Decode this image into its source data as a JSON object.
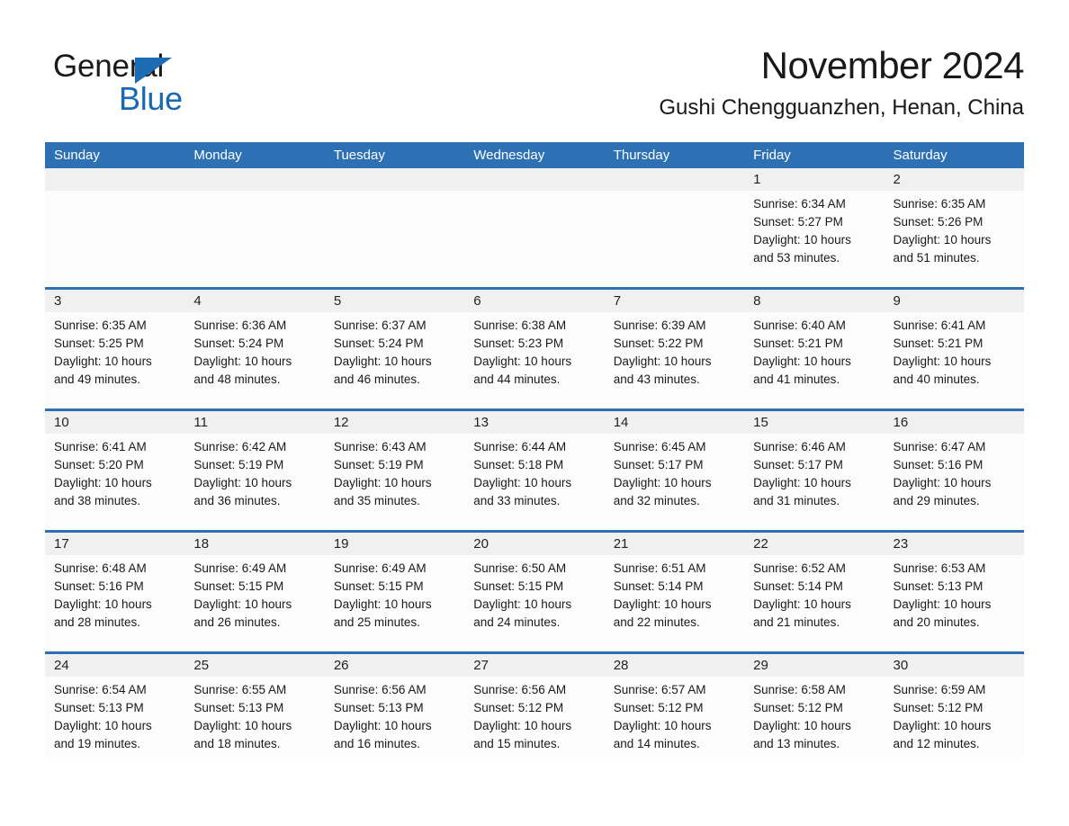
{
  "brand": {
    "name_part1": "General",
    "name_part2": "Blue",
    "accent_color": "#1769b5",
    "triangle_icon": "logo-triangle-icon"
  },
  "header": {
    "month_title": "November 2024",
    "location": "Gushi Chengguanzhen, Henan, China"
  },
  "calendar": {
    "header_bg_color": "#2d71b4",
    "weekdays": [
      "Sunday",
      "Monday",
      "Tuesday",
      "Wednesday",
      "Thursday",
      "Friday",
      "Saturday"
    ],
    "weeks": [
      [
        {
          "day": "",
          "sunrise": "",
          "sunset": "",
          "daylight_line1": "",
          "daylight_line2": ""
        },
        {
          "day": "",
          "sunrise": "",
          "sunset": "",
          "daylight_line1": "",
          "daylight_line2": ""
        },
        {
          "day": "",
          "sunrise": "",
          "sunset": "",
          "daylight_line1": "",
          "daylight_line2": ""
        },
        {
          "day": "",
          "sunrise": "",
          "sunset": "",
          "daylight_line1": "",
          "daylight_line2": ""
        },
        {
          "day": "",
          "sunrise": "",
          "sunset": "",
          "daylight_line1": "",
          "daylight_line2": ""
        },
        {
          "day": "1",
          "sunrise": "Sunrise: 6:34 AM",
          "sunset": "Sunset: 5:27 PM",
          "daylight_line1": "Daylight: 10 hours",
          "daylight_line2": "and 53 minutes."
        },
        {
          "day": "2",
          "sunrise": "Sunrise: 6:35 AM",
          "sunset": "Sunset: 5:26 PM",
          "daylight_line1": "Daylight: 10 hours",
          "daylight_line2": "and 51 minutes."
        }
      ],
      [
        {
          "day": "3",
          "sunrise": "Sunrise: 6:35 AM",
          "sunset": "Sunset: 5:25 PM",
          "daylight_line1": "Daylight: 10 hours",
          "daylight_line2": "and 49 minutes."
        },
        {
          "day": "4",
          "sunrise": "Sunrise: 6:36 AM",
          "sunset": "Sunset: 5:24 PM",
          "daylight_line1": "Daylight: 10 hours",
          "daylight_line2": "and 48 minutes."
        },
        {
          "day": "5",
          "sunrise": "Sunrise: 6:37 AM",
          "sunset": "Sunset: 5:24 PM",
          "daylight_line1": "Daylight: 10 hours",
          "daylight_line2": "and 46 minutes."
        },
        {
          "day": "6",
          "sunrise": "Sunrise: 6:38 AM",
          "sunset": "Sunset: 5:23 PM",
          "daylight_line1": "Daylight: 10 hours",
          "daylight_line2": "and 44 minutes."
        },
        {
          "day": "7",
          "sunrise": "Sunrise: 6:39 AM",
          "sunset": "Sunset: 5:22 PM",
          "daylight_line1": "Daylight: 10 hours",
          "daylight_line2": "and 43 minutes."
        },
        {
          "day": "8",
          "sunrise": "Sunrise: 6:40 AM",
          "sunset": "Sunset: 5:21 PM",
          "daylight_line1": "Daylight: 10 hours",
          "daylight_line2": "and 41 minutes."
        },
        {
          "day": "9",
          "sunrise": "Sunrise: 6:41 AM",
          "sunset": "Sunset: 5:21 PM",
          "daylight_line1": "Daylight: 10 hours",
          "daylight_line2": "and 40 minutes."
        }
      ],
      [
        {
          "day": "10",
          "sunrise": "Sunrise: 6:41 AM",
          "sunset": "Sunset: 5:20 PM",
          "daylight_line1": "Daylight: 10 hours",
          "daylight_line2": "and 38 minutes."
        },
        {
          "day": "11",
          "sunrise": "Sunrise: 6:42 AM",
          "sunset": "Sunset: 5:19 PM",
          "daylight_line1": "Daylight: 10 hours",
          "daylight_line2": "and 36 minutes."
        },
        {
          "day": "12",
          "sunrise": "Sunrise: 6:43 AM",
          "sunset": "Sunset: 5:19 PM",
          "daylight_line1": "Daylight: 10 hours",
          "daylight_line2": "and 35 minutes."
        },
        {
          "day": "13",
          "sunrise": "Sunrise: 6:44 AM",
          "sunset": "Sunset: 5:18 PM",
          "daylight_line1": "Daylight: 10 hours",
          "daylight_line2": "and 33 minutes."
        },
        {
          "day": "14",
          "sunrise": "Sunrise: 6:45 AM",
          "sunset": "Sunset: 5:17 PM",
          "daylight_line1": "Daylight: 10 hours",
          "daylight_line2": "and 32 minutes."
        },
        {
          "day": "15",
          "sunrise": "Sunrise: 6:46 AM",
          "sunset": "Sunset: 5:17 PM",
          "daylight_line1": "Daylight: 10 hours",
          "daylight_line2": "and 31 minutes."
        },
        {
          "day": "16",
          "sunrise": "Sunrise: 6:47 AM",
          "sunset": "Sunset: 5:16 PM",
          "daylight_line1": "Daylight: 10 hours",
          "daylight_line2": "and 29 minutes."
        }
      ],
      [
        {
          "day": "17",
          "sunrise": "Sunrise: 6:48 AM",
          "sunset": "Sunset: 5:16 PM",
          "daylight_line1": "Daylight: 10 hours",
          "daylight_line2": "and 28 minutes."
        },
        {
          "day": "18",
          "sunrise": "Sunrise: 6:49 AM",
          "sunset": "Sunset: 5:15 PM",
          "daylight_line1": "Daylight: 10 hours",
          "daylight_line2": "and 26 minutes."
        },
        {
          "day": "19",
          "sunrise": "Sunrise: 6:49 AM",
          "sunset": "Sunset: 5:15 PM",
          "daylight_line1": "Daylight: 10 hours",
          "daylight_line2": "and 25 minutes."
        },
        {
          "day": "20",
          "sunrise": "Sunrise: 6:50 AM",
          "sunset": "Sunset: 5:15 PM",
          "daylight_line1": "Daylight: 10 hours",
          "daylight_line2": "and 24 minutes."
        },
        {
          "day": "21",
          "sunrise": "Sunrise: 6:51 AM",
          "sunset": "Sunset: 5:14 PM",
          "daylight_line1": "Daylight: 10 hours",
          "daylight_line2": "and 22 minutes."
        },
        {
          "day": "22",
          "sunrise": "Sunrise: 6:52 AM",
          "sunset": "Sunset: 5:14 PM",
          "daylight_line1": "Daylight: 10 hours",
          "daylight_line2": "and 21 minutes."
        },
        {
          "day": "23",
          "sunrise": "Sunrise: 6:53 AM",
          "sunset": "Sunset: 5:13 PM",
          "daylight_line1": "Daylight: 10 hours",
          "daylight_line2": "and 20 minutes."
        }
      ],
      [
        {
          "day": "24",
          "sunrise": "Sunrise: 6:54 AM",
          "sunset": "Sunset: 5:13 PM",
          "daylight_line1": "Daylight: 10 hours",
          "daylight_line2": "and 19 minutes."
        },
        {
          "day": "25",
          "sunrise": "Sunrise: 6:55 AM",
          "sunset": "Sunset: 5:13 PM",
          "daylight_line1": "Daylight: 10 hours",
          "daylight_line2": "and 18 minutes."
        },
        {
          "day": "26",
          "sunrise": "Sunrise: 6:56 AM",
          "sunset": "Sunset: 5:13 PM",
          "daylight_line1": "Daylight: 10 hours",
          "daylight_line2": "and 16 minutes."
        },
        {
          "day": "27",
          "sunrise": "Sunrise: 6:56 AM",
          "sunset": "Sunset: 5:12 PM",
          "daylight_line1": "Daylight: 10 hours",
          "daylight_line2": "and 15 minutes."
        },
        {
          "day": "28",
          "sunrise": "Sunrise: 6:57 AM",
          "sunset": "Sunset: 5:12 PM",
          "daylight_line1": "Daylight: 10 hours",
          "daylight_line2": "and 14 minutes."
        },
        {
          "day": "29",
          "sunrise": "Sunrise: 6:58 AM",
          "sunset": "Sunset: 5:12 PM",
          "daylight_line1": "Daylight: 10 hours",
          "daylight_line2": "and 13 minutes."
        },
        {
          "day": "30",
          "sunrise": "Sunrise: 6:59 AM",
          "sunset": "Sunset: 5:12 PM",
          "daylight_line1": "Daylight: 10 hours",
          "daylight_line2": "and 12 minutes."
        }
      ]
    ]
  }
}
